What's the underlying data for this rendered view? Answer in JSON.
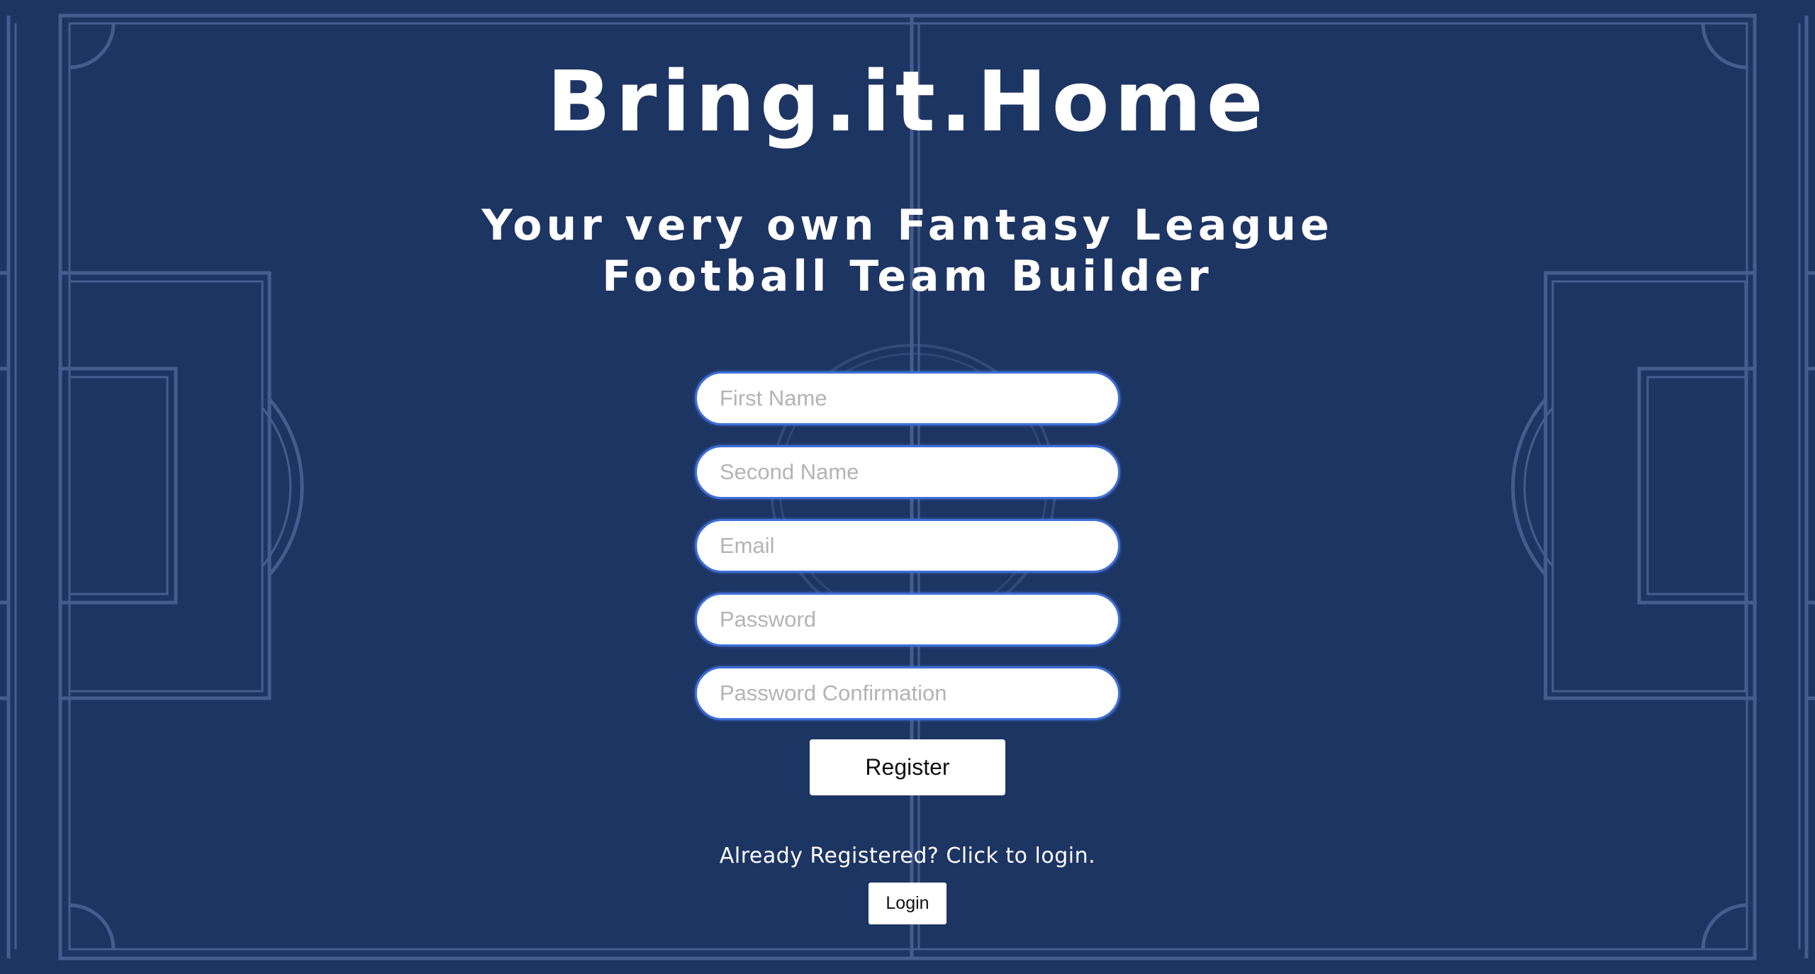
{
  "header": {
    "title": "Bring.it.Home",
    "subtitle_line1": "Your very own Fantasy League",
    "subtitle_line2": "Football Team Builder"
  },
  "form": {
    "first_name_placeholder": "First Name",
    "second_name_placeholder": "Second Name",
    "email_placeholder": "Email",
    "password_placeholder": "Password",
    "password_confirmation_placeholder": "Password Confirmation",
    "first_name_value": "",
    "second_name_value": "",
    "email_value": "",
    "password_value": "",
    "password_confirmation_value": "",
    "register_label": "Register"
  },
  "login": {
    "prompt": "Already Registered? Click to login.",
    "button_label": "Login"
  },
  "colors": {
    "background": "#1d3563",
    "pitch_lines": "#4b6596",
    "field_border": "#3f6fd8",
    "text": "#ffffff"
  }
}
